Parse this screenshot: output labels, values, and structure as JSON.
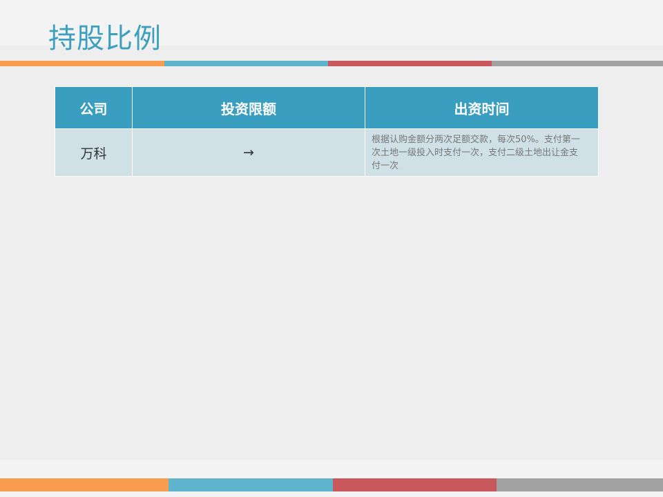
{
  "title": "持股比例",
  "colors": {
    "orange": "#f79d4d",
    "blue": "#5eb4cd",
    "red": "#c8585c",
    "gray": "#a2a2a2",
    "header": "#3a9ec1",
    "row": "#cfe0e7"
  },
  "table": {
    "headers": [
      "公司",
      "投资限额",
      "出资时间"
    ],
    "rows": [
      {
        "company": "万科",
        "limit": "→",
        "time": "根据认购金额分两次足额交款，每次50%。支付第一次土地一级投入时支付一次，支付二级土地出让金支付一次"
      }
    ]
  }
}
